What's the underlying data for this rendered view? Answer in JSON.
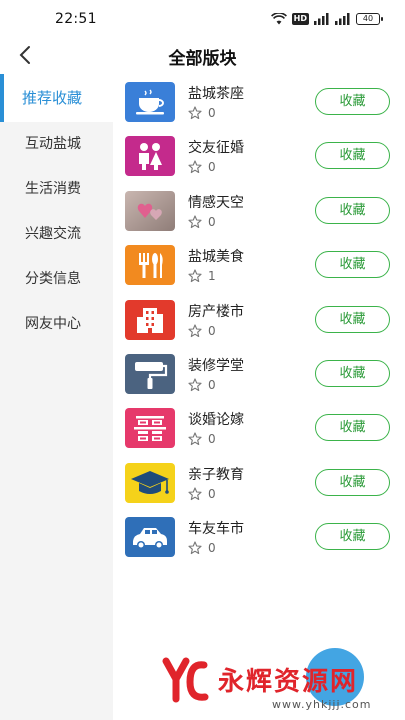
{
  "status_bar": {
    "time": "22:51",
    "battery": "40",
    "hd_label": "HD"
  },
  "header": {
    "title": "全部版块"
  },
  "sidebar": {
    "items": [
      {
        "label": "推荐收藏"
      },
      {
        "label": "互动盐城"
      },
      {
        "label": "生活消费"
      },
      {
        "label": "兴趣交流"
      },
      {
        "label": "分类信息"
      },
      {
        "label": "网友中心"
      }
    ]
  },
  "forums": [
    {
      "name": "盐城茶座",
      "favorites": "0",
      "button": "收藏",
      "icon": "teacup-icon"
    },
    {
      "name": "交友征婚",
      "favorites": "0",
      "button": "收藏",
      "icon": "couple-icon"
    },
    {
      "name": "情感天空",
      "favorites": "0",
      "button": "收藏",
      "icon": "heart-photo-icon"
    },
    {
      "name": "盐城美食",
      "favorites": "1",
      "button": "收藏",
      "icon": "cutlery-icon"
    },
    {
      "name": "房产楼市",
      "favorites": "0",
      "button": "收藏",
      "icon": "building-icon"
    },
    {
      "name": "装修学堂",
      "favorites": "0",
      "button": "收藏",
      "icon": "paint-roller-icon"
    },
    {
      "name": "谈婚论嫁",
      "favorites": "0",
      "button": "收藏",
      "icon": "double-happiness-icon"
    },
    {
      "name": "亲子教育",
      "favorites": "0",
      "button": "收藏",
      "icon": "graduation-cap-icon"
    },
    {
      "name": "车友车市",
      "favorites": "0",
      "button": "收藏",
      "icon": "car-icon"
    }
  ],
  "watermark": {
    "text": "永辉资源网",
    "url": "www.yhkjjj.com"
  },
  "colors": {
    "accent_blue": "#2a8fd6",
    "button_green": "#3bb34a",
    "sidebar_bg": "#f4f4f4"
  }
}
